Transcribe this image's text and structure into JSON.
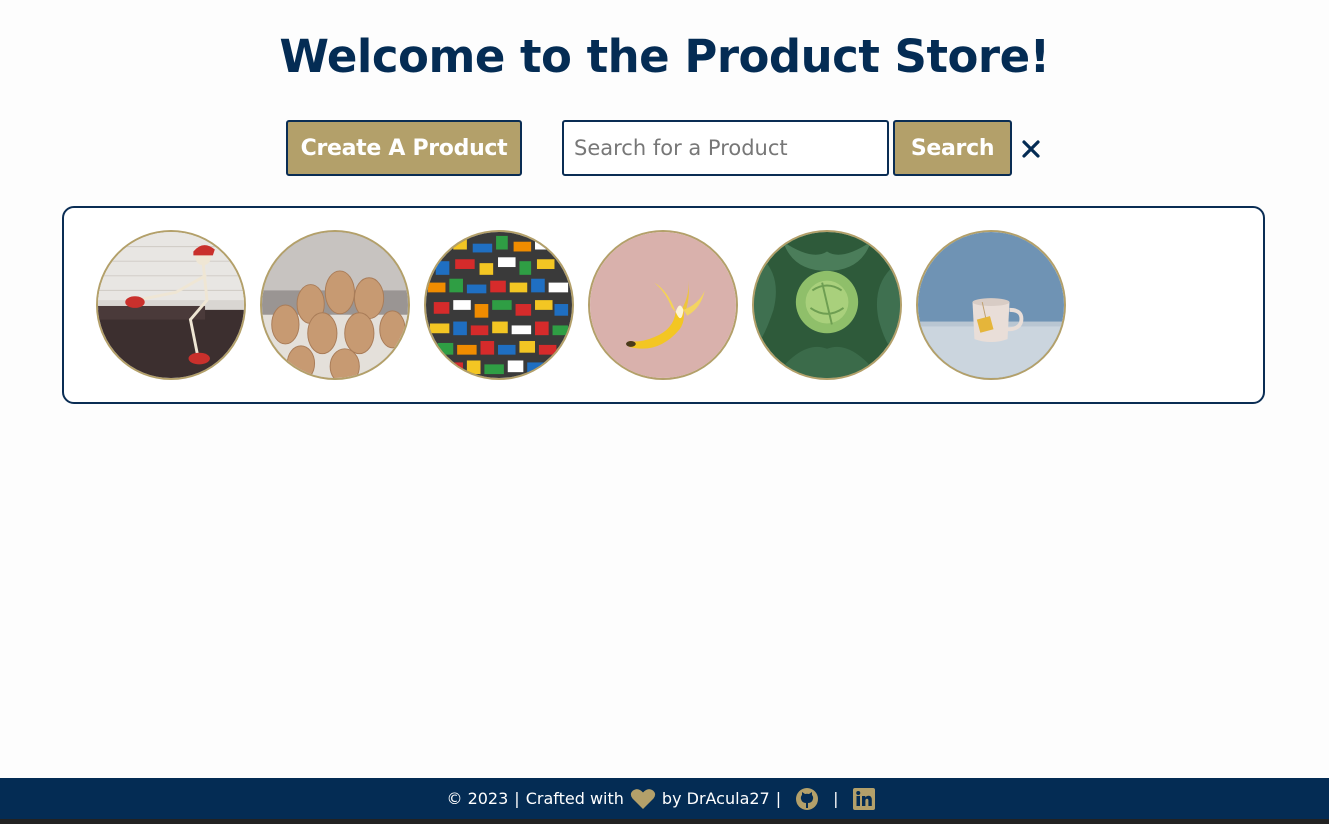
{
  "header": {
    "title": "Welcome to the Product Store!"
  },
  "toolbar": {
    "create_label": "Create A Product",
    "search_placeholder": "Search for a Product",
    "search_value": "",
    "search_label": "Search",
    "clear_glyph": "✕"
  },
  "products": [
    {
      "image": "skeleton-sitting-on-couch"
    },
    {
      "image": "eggs-in-carton"
    },
    {
      "image": "lego-bricks-pile"
    },
    {
      "image": "peeled-banana"
    },
    {
      "image": "cabbage"
    },
    {
      "image": "mug-with-tea-bag"
    }
  ],
  "footer": {
    "copyright": "© 2023",
    "crafted": "Crafted with",
    "by": "by DrAcula27",
    "sep": "|",
    "github_icon": "github-icon",
    "linkedin_icon": "linkedin-icon"
  },
  "colors": {
    "navy": "#042c54",
    "gold": "#b3a06a",
    "background": "#fdfdfd"
  }
}
